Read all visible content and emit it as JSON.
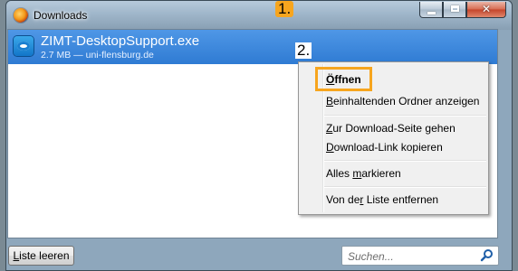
{
  "window": {
    "title": "Downloads"
  },
  "download": {
    "file_name": "ZIMT-DesktopSupport.exe",
    "meta": "2.7 MB — uni-flensburg.de"
  },
  "annotations": {
    "step1": "1.",
    "step2": "2."
  },
  "context_menu": {
    "open": {
      "ul": "Ö",
      "rest": "ffnen"
    },
    "show_folder": {
      "ul": "B",
      "rest": "einhaltenden Ordner anzeigen"
    },
    "goto_page": {
      "ul": "Z",
      "rest": "ur Download-Seite gehen"
    },
    "copy_link": {
      "ul": "D",
      "rest": "ownload-Link kopieren"
    },
    "select_all": {
      "pre": "Alles ",
      "ul": "m",
      "rest": "arkieren"
    },
    "remove": {
      "pre": "Von de",
      "ul": "r",
      "rest": " Liste entfernen"
    }
  },
  "footer": {
    "clear": {
      "ul": "L",
      "rest": "iste leeren"
    },
    "search_placeholder": "Suchen..."
  },
  "colors": {
    "selection": "#3a86dc",
    "annotation": "#f7a51e"
  }
}
